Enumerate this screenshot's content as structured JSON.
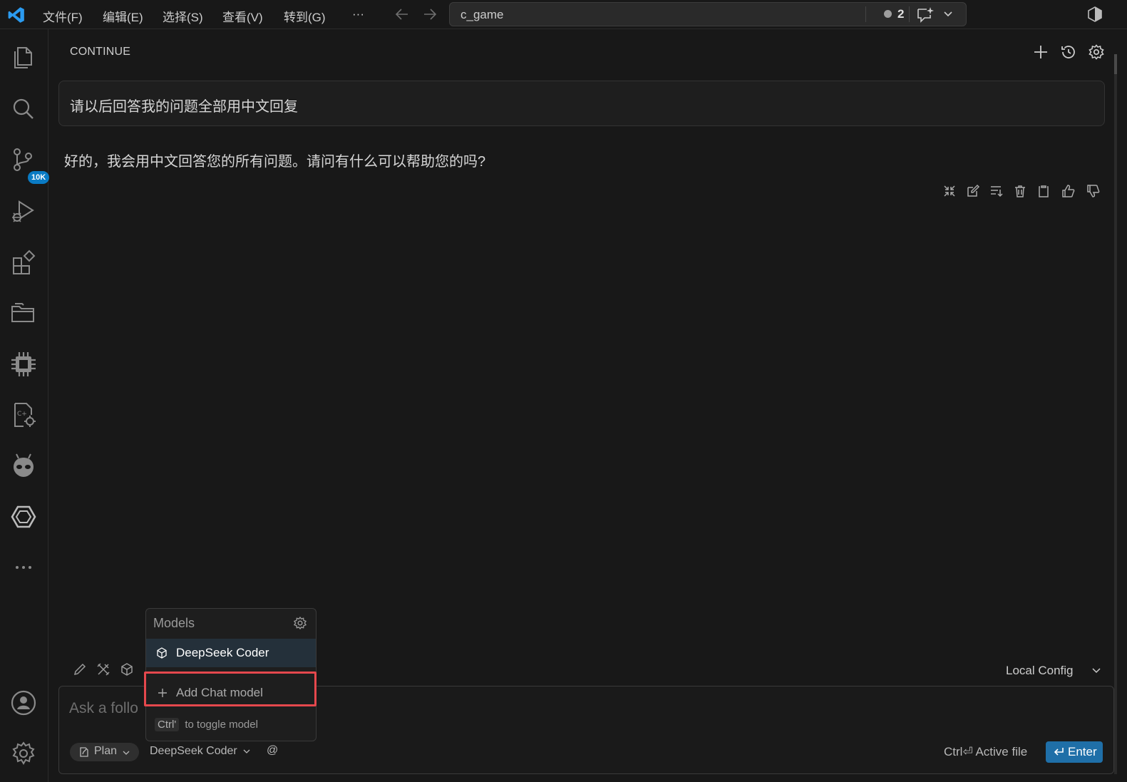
{
  "menu": [
    "文件(F)",
    "编辑(E)",
    "选择(S)",
    "查看(V)",
    "转到(G)",
    "···"
  ],
  "search": {
    "text": "c_game",
    "count": "2"
  },
  "activity": {
    "source_control_badge": "10K"
  },
  "panel": {
    "title": "CONTINUE"
  },
  "chat": {
    "user_message": "请以后回答我的问题全部用中文回复",
    "assistant_reply": "好的，我会用中文回答您的所有问题。请问有什么可以帮助您的吗?"
  },
  "toolbar": {
    "local_config": "Local Config"
  },
  "input": {
    "placeholder": "Ask a follo",
    "mode": "Plan",
    "model": "DeepSeek Coder",
    "at": "@",
    "active_file": "Ctrl⏎ Active file",
    "enter": "Enter"
  },
  "models_popup": {
    "title": "Models",
    "items": [
      "DeepSeek Coder"
    ],
    "add_label": "Add Chat model",
    "shortcut_key": "Ctrl'",
    "shortcut_text": "to toggle model"
  },
  "colors": {
    "accent": "#1f6fa8",
    "highlight": "#e5484d",
    "badge": "#0a7bc4"
  }
}
